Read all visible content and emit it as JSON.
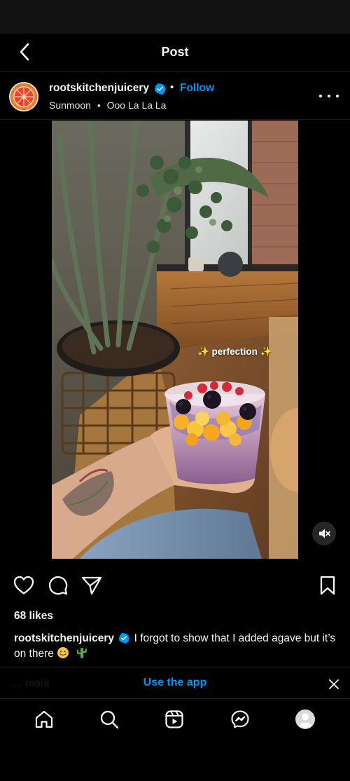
{
  "header": {
    "title": "Post",
    "back_icon": "chevron-left-icon"
  },
  "post": {
    "username": "rootskitchenjuicery",
    "verified": true,
    "separator": "•",
    "follow_label": "Follow",
    "audio": {
      "artist": "Sunmoon",
      "separator": "•",
      "track": "Ooo La La La"
    },
    "media_overlay_text": "✨ perfection ✨",
    "likes_text": "68 likes",
    "caption": {
      "username": "rootskitchenjuicery",
      "text": "I forgot to show that I added agave but it’s on there",
      "emojis": [
        "smiling-face-emoji",
        "cactus-emoji"
      ]
    },
    "more_text": "... more"
  },
  "banner": {
    "use_app_label": "Use the app"
  },
  "nav": {
    "items": [
      "home-icon",
      "search-icon",
      "reels-icon",
      "messenger-icon",
      "profile-icon"
    ]
  },
  "colors": {
    "accent": "#0095f6",
    "background": "#000000",
    "text": "#f5f5f5"
  }
}
